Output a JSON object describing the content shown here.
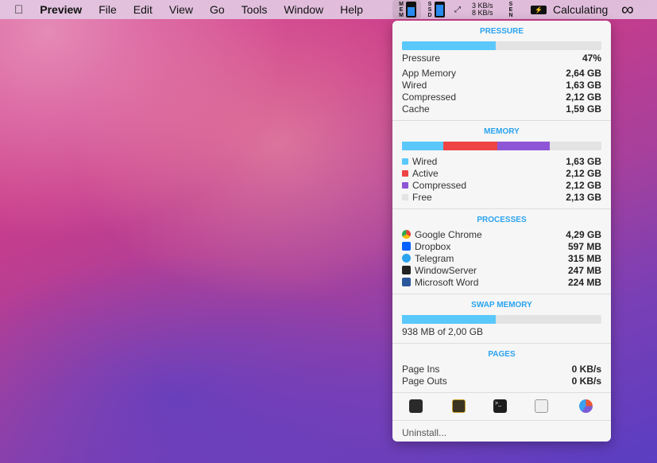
{
  "menubar": {
    "app": "Preview",
    "items": [
      "File",
      "Edit",
      "View",
      "Go",
      "Tools",
      "Window",
      "Help"
    ],
    "status": {
      "mem_label": "MEM",
      "ssd_label": "SSD",
      "net_up": "3 KB/s",
      "net_down": "8 KB/s",
      "sensors_label": "SEN",
      "battery_text": "Calculating"
    }
  },
  "panel": {
    "pressure": {
      "title": "PRESSURE",
      "percent": 47,
      "rows": [
        {
          "label": "Pressure",
          "value": "47%"
        },
        {
          "label": "App Memory",
          "value": "2,64 GB"
        },
        {
          "label": "Wired",
          "value": "1,63 GB"
        },
        {
          "label": "Compressed",
          "value": "2,12 GB"
        },
        {
          "label": "Cache",
          "value": "1,59 GB"
        }
      ]
    },
    "memory": {
      "title": "MEMORY",
      "rows": [
        {
          "label": "Wired",
          "value": "1,63 GB",
          "color": "#5ac8fa"
        },
        {
          "label": "Active",
          "value": "2,12 GB",
          "color": "#ef4444"
        },
        {
          "label": "Compressed",
          "value": "2,12 GB",
          "color": "#8e55d6"
        },
        {
          "label": "Free",
          "value": "2,13 GB",
          "color": "#e3e3e3"
        }
      ]
    },
    "processes": {
      "title": "PROCESSES",
      "rows": [
        {
          "label": "Google Chrome",
          "value": "4,29 GB",
          "icon": "chrome-icon"
        },
        {
          "label": "Dropbox",
          "value": "597 MB",
          "icon": "dropbox-icon"
        },
        {
          "label": "Telegram",
          "value": "315 MB",
          "icon": "telegram-icon"
        },
        {
          "label": "WindowServer",
          "value": "247 MB",
          "icon": "windowserver-icon"
        },
        {
          "label": "Microsoft Word",
          "value": "224 MB",
          "icon": "word-icon"
        }
      ]
    },
    "swap": {
      "title": "SWAP MEMORY",
      "percent": 46.9,
      "text": "938 MB of 2,00 GB"
    },
    "pages": {
      "title": "PAGES",
      "rows": [
        {
          "label": "Page Ins",
          "value": "0 KB/s"
        },
        {
          "label": "Page Outs",
          "value": "0 KB/s"
        }
      ]
    },
    "apps": [
      "activity-monitor-icon",
      "console-icon",
      "terminal-icon",
      "system-information-icon",
      "disk-utility-icon"
    ],
    "uninstall": "Uninstall..."
  }
}
